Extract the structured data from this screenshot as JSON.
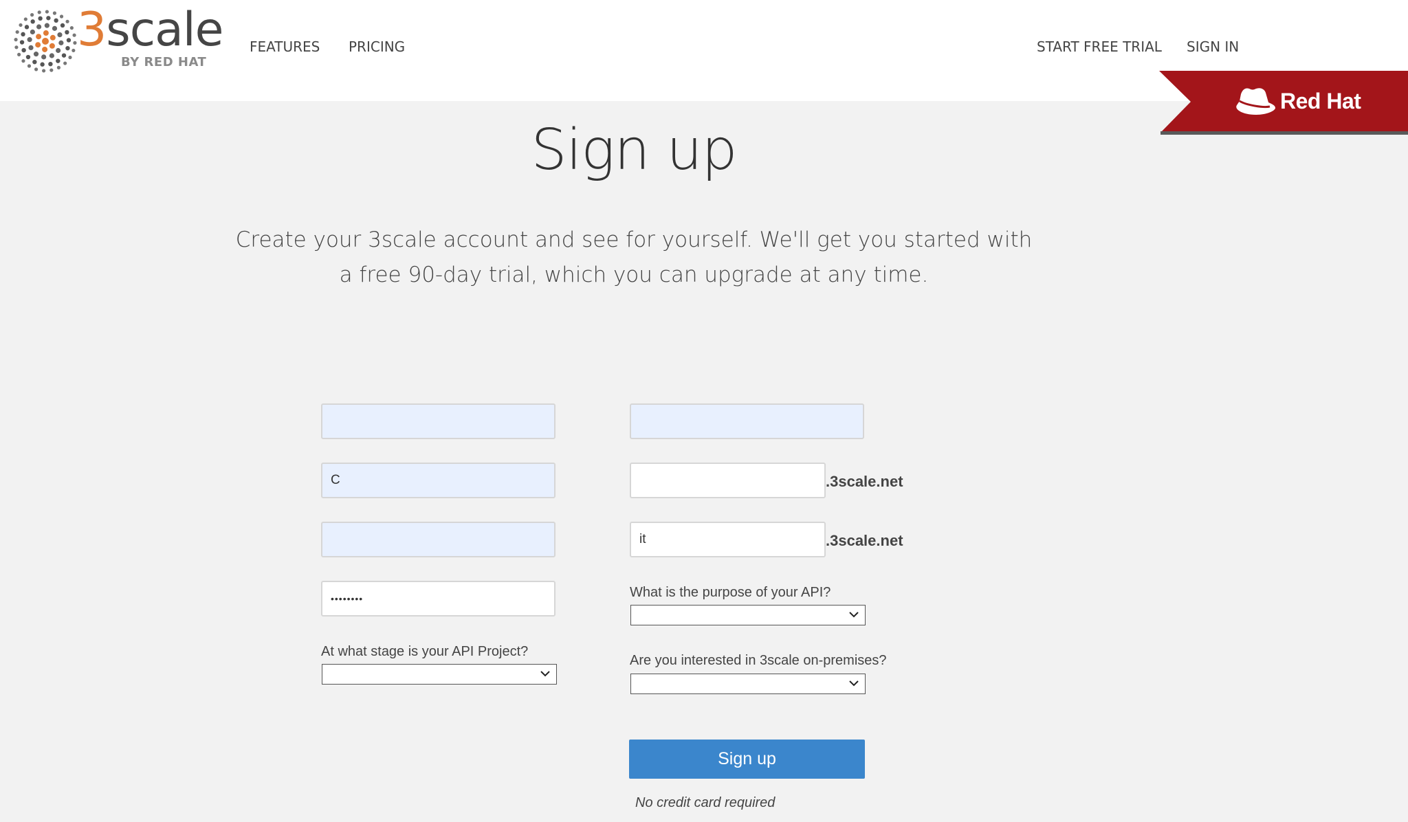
{
  "brand": {
    "word_prefix": "3",
    "word_rest": "scale",
    "byline": "BY RED HAT",
    "ribbon_text": "Red Hat",
    "accent_color": "#e07c36",
    "ribbon_color": "#a3151a",
    "logo_icon": "3scale-dots-logo-icon",
    "ribbon_icon": "red-hat-fedora-icon"
  },
  "nav": {
    "features": "FEATURES",
    "pricing": "PRICING",
    "start_trial": "START FREE TRIAL",
    "sign_in": "SIGN IN"
  },
  "page": {
    "title": "Sign up",
    "intro": "Create your 3scale account and see for yourself. We'll get you started with a free 90-day trial, which you can upgrade at any time."
  },
  "form": {
    "first_name_value": "",
    "last_name_value": "",
    "org_name_value": "C",
    "email_value": "",
    "password_value": "••••••••",
    "subdomain_value": "",
    "subdomain_suffix": ".3scale.net",
    "admin_subdomain_value": "it",
    "admin_subdomain_suffix": ".3scale.net",
    "purpose_label": "What is the purpose of your API?",
    "purpose_value": "",
    "stage_label": "At what stage is your API Project?",
    "stage_value": "",
    "onprem_label": "Are you interested in 3scale on-premises?",
    "onprem_value": "",
    "submit_label": "Sign up",
    "note": "No credit card required"
  }
}
